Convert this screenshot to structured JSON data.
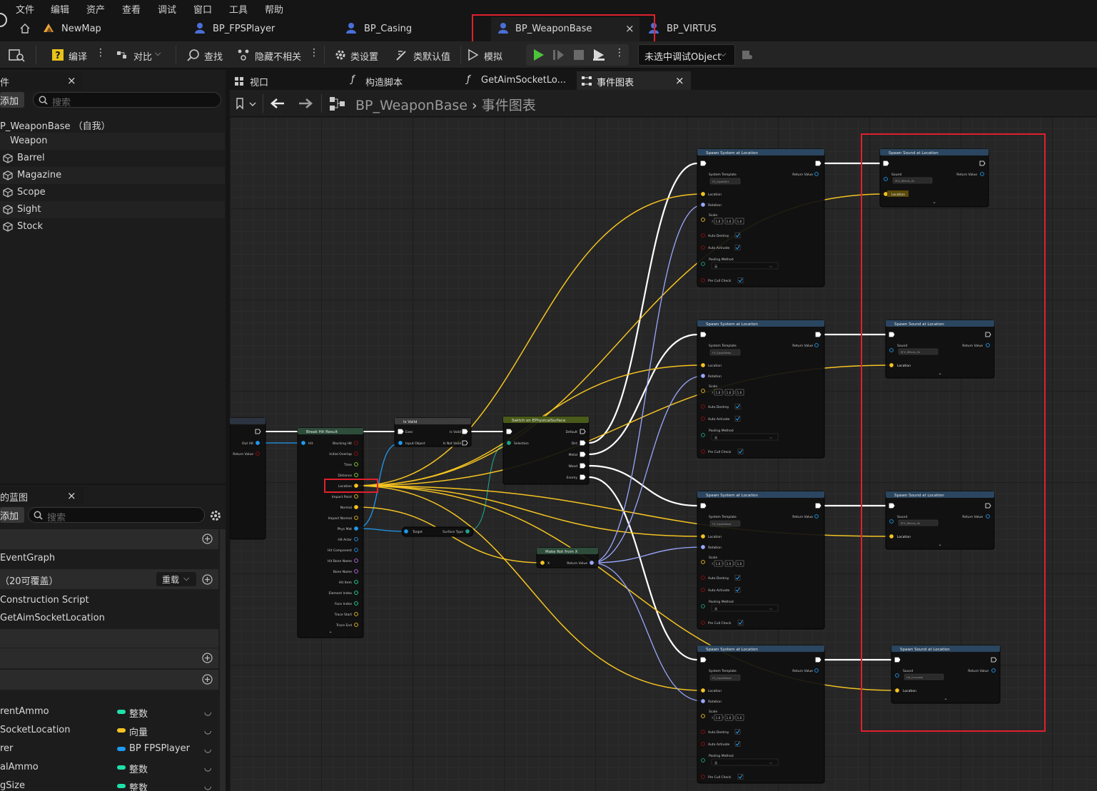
{
  "menu": [
    "文件",
    "编辑",
    "资产",
    "查看",
    "调试",
    "窗口",
    "工具",
    "帮助"
  ],
  "doc_tabs": [
    "NewMap",
    "BP_FPSPlayer",
    "BP_Casing",
    "BP_WeaponBase",
    "BP_VIRTUS"
  ],
  "doc_tab_close": "×",
  "toolbar": {
    "compile": "编译",
    "diff": "对比",
    "find": "查找",
    "hide_unrelated": "隐藏不相关",
    "class_settings": "类设置",
    "class_defaults": "类默认值",
    "simulate": "模拟",
    "debug_object": "未选中调试Object"
  },
  "components_panel": {
    "title": "件",
    "add": "添加",
    "search_placeholder": "搜索",
    "root": "P_WeaponBase （自我）",
    "items": [
      "Weapon",
      "Barrel",
      "Magazine",
      "Scope",
      "Sight",
      "Stock"
    ]
  },
  "graph_tabs": {
    "viewport": "视口",
    "construction": "构造脚本",
    "get_aim": "GetAimSocketLo...",
    "event_graph": "事件图表"
  },
  "breadcrumb": {
    "blueprint": "BP_WeaponBase",
    "graph": "事件图表"
  },
  "my_blueprint": {
    "title": "的蓝图",
    "add": "添加",
    "search_placeholder": "搜索",
    "event_graph": "EventGraph",
    "overrides": "（20可覆盖）",
    "override_btn": "重载",
    "functions": [
      "Construction Script",
      "GetAimSocketLocation"
    ],
    "variables": [
      {
        "name": "rentAmmo",
        "type": "整数",
        "color": "#1fe0a8"
      },
      {
        "name": "SocketLocation",
        "type": "向量",
        "color": "#f4c321"
      },
      {
        "name": "rer",
        "type": "BP FPSPlayer",
        "color": "#1e9af0"
      },
      {
        "name": "alAmmo",
        "type": "整数",
        "color": "#1fe0a8"
      },
      {
        "name": "gSize",
        "type": "整数",
        "color": "#1fe0a8"
      }
    ]
  },
  "nodes": {
    "break_hit": {
      "title": "Break Hit Result",
      "input": "Hit",
      "pins": [
        "Blocking Hit",
        "Initial Overlap",
        "Time",
        "Distance",
        "Location",
        "Impact Point",
        "Normal",
        "Impact Normal",
        "Phys Mat",
        "Hit Actor",
        "Hit Component",
        "Hit Bone Name",
        "Bone Name",
        "Hit Item",
        "Element Index",
        "Face Index",
        "Trace Start",
        "Trace End"
      ]
    },
    "prev_node": {
      "out_hit": "Out Hit",
      "return_value": "Return Value"
    },
    "is_valid": {
      "title": "Is Valid",
      "exec": "Exec",
      "input_object": "Input Object",
      "is_valid": "Is Valid",
      "is_not_valid": "Is Not Valid"
    },
    "get_surface": {
      "target": "Target",
      "surface_type": "Surface Type"
    },
    "switch": {
      "title": "Switch on EPhysicalSurface",
      "selection": "Selection",
      "outs": [
        "Default",
        "Dirt",
        "Metal",
        "Wood",
        "Enemy"
      ]
    },
    "make_rot": {
      "title": "Make Rot from X",
      "x": "X",
      "return_value": "Return Value"
    },
    "spawn_system": {
      "title": "Spawn System at Location",
      "system_template": "System Template",
      "return_value": "Return Value",
      "location": "Location",
      "rotation": "Rotation",
      "scale": "Scale",
      "auto_destroy": "Auto Destroy",
      "auto_activate": "Auto Activate",
      "pooling": "Pooling Method",
      "pooling_value": "无",
      "pre_cull": "Pre Cull Check",
      "scale_vals": [
        "1.0",
        "1.0",
        "1.0"
      ],
      "templates": [
        "FX_SquibDirt",
        "FX_SquibMetal",
        "FX_SquibWood",
        "FX_SquibBlood"
      ]
    },
    "spawn_sound": {
      "title": "Spawn Sound at Location",
      "sound": "Sound",
      "return_value": "Return Value",
      "location": "Location",
      "sounds": [
        "SFX_Wfects_Sh",
        "SFX_Wfects_Sh",
        "SFX_Wfects_Sh",
        "Hit_Concrete"
      ]
    }
  },
  "colors": {
    "highlight_box": "#e0202c",
    "exec": "#ffffff",
    "vector": "#f4c321",
    "object": "#1e9af0",
    "rotator": "#9aa8ff",
    "bool": "#9a0f0f"
  }
}
